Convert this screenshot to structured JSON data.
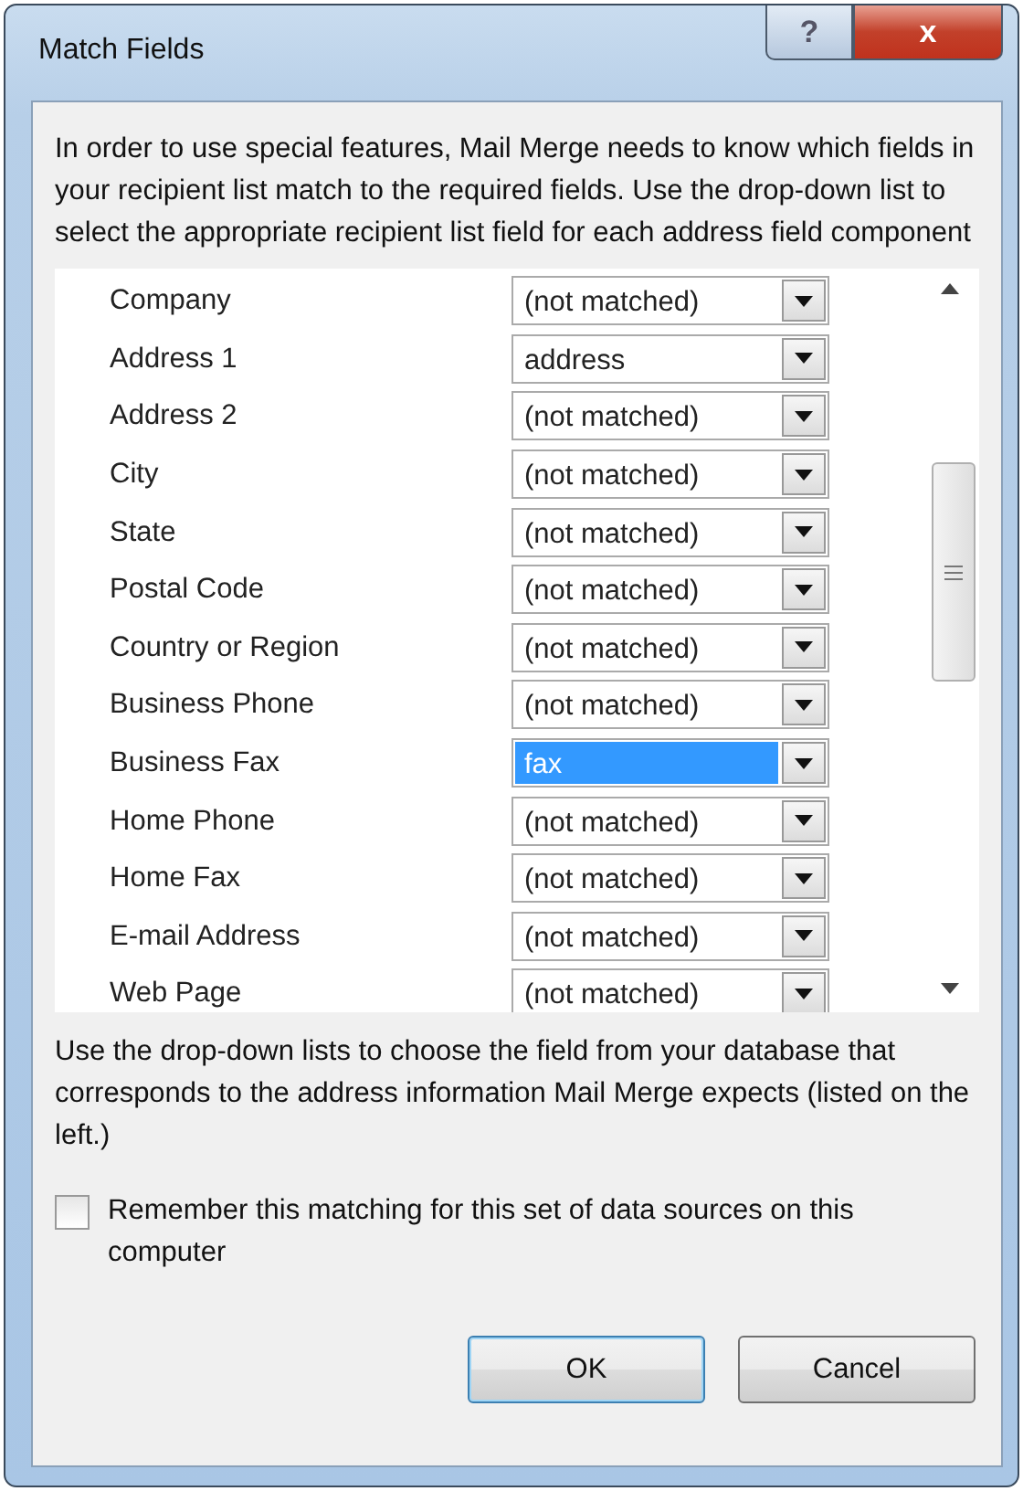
{
  "window": {
    "title": "Match Fields",
    "buttons": [
      {
        "kind": "help",
        "label": "?"
      },
      {
        "kind": "close",
        "label": "x"
      }
    ]
  },
  "instructions": "In order to use special features, Mail Merge needs to know which fields in your recipient list match to the required fields.  Use the drop-down list to select the appropriate recipient list field for each address field component",
  "fields": [
    {
      "label": "Company",
      "value": "(not matched)",
      "selected": false
    },
    {
      "label": "Address 1",
      "value": "address",
      "selected": false
    },
    {
      "label": "Address 2",
      "value": "(not matched)",
      "selected": false
    },
    {
      "label": "City",
      "value": "(not matched)",
      "selected": false
    },
    {
      "label": "State",
      "value": "(not matched)",
      "selected": false
    },
    {
      "label": "Postal Code",
      "value": "(not matched)",
      "selected": false
    },
    {
      "label": "Country or Region",
      "value": "(not matched)",
      "selected": false
    },
    {
      "label": "Business Phone",
      "value": "(not matched)",
      "selected": false
    },
    {
      "label": "Business Fax",
      "value": "fax",
      "selected": true
    },
    {
      "label": "Home Phone",
      "value": "(not matched)",
      "selected": false
    },
    {
      "label": "Home Fax",
      "value": "(not matched)",
      "selected": false
    },
    {
      "label": "E-mail Address",
      "value": "(not matched)",
      "selected": false
    },
    {
      "label": "Web Page",
      "value": "(not matched)",
      "selected": false
    }
  ],
  "note": "Use the drop-down lists to choose the field from your database that corresponds to the address information Mail Merge expects (listed on the left.)",
  "remember": {
    "label": "Remember this matching for this set of data sources on this computer",
    "checked": false
  },
  "buttons": [
    {
      "label": "OK",
      "default": true
    },
    {
      "label": "Cancel",
      "default": false
    }
  ]
}
